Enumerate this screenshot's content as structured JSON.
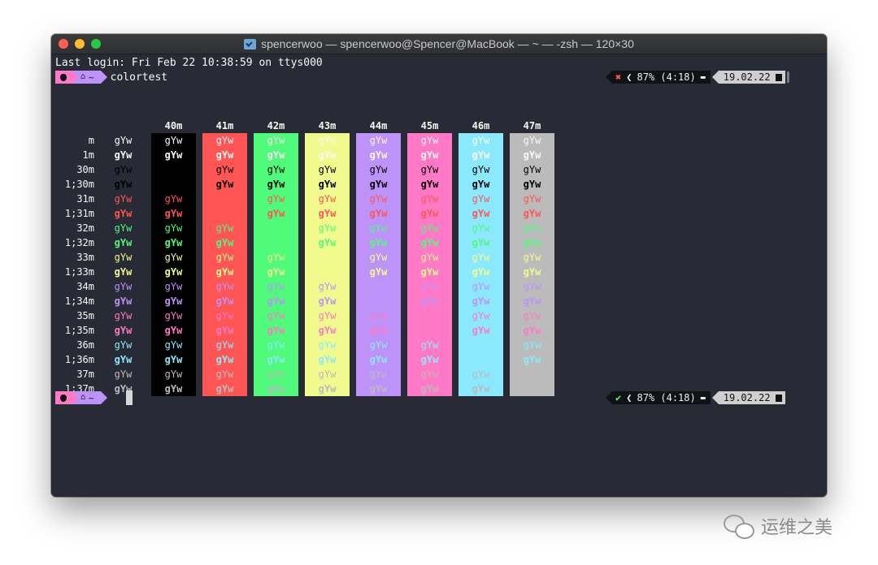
{
  "window": {
    "title": "spencerwoo — spencerwoo@Spencer@MacBook — ~ — -zsh — 120×30",
    "background": "#282a36"
  },
  "terminal": {
    "last_login": "Last login: Fri Feb 22 10:38:59 on ttys000",
    "prompt_dir": "~",
    "command": "colortest",
    "right_prompt": {
      "battery": "87% (4:18)",
      "date": "19.02.22",
      "first_status": "✖",
      "second_status": "✔"
    },
    "foreground": "#f8f8f2"
  },
  "colortest": {
    "sample_text": "gYw",
    "column_headers": [
      "40m",
      "41m",
      "42m",
      "43m",
      "44m",
      "45m",
      "46m",
      "47m"
    ],
    "row_labels": [
      "m",
      "1m",
      "30m",
      "1;30m",
      "31m",
      "1;31m",
      "32m",
      "1;32m",
      "33m",
      "1;33m",
      "34m",
      "1;34m",
      "35m",
      "1;35m",
      "36m",
      "1;36m",
      "37m",
      "1;37m"
    ],
    "bg_colors": [
      "#000000",
      "#ff5555",
      "#50fa7b",
      "#f1fa8c",
      "#bd93f9",
      "#ff79c6",
      "#8be9fd",
      "#bbbbbb"
    ],
    "fg_colors": [
      "#000000",
      "#ff5555",
      "#50fa7b",
      "#f1fa8c",
      "#bd93f9",
      "#ff79c6",
      "#8be9fd",
      "#bbbbbb"
    ],
    "default_fg": "#f8f8f2"
  },
  "watermark": {
    "text": "运维之美",
    "icon": "wechat-icon"
  }
}
